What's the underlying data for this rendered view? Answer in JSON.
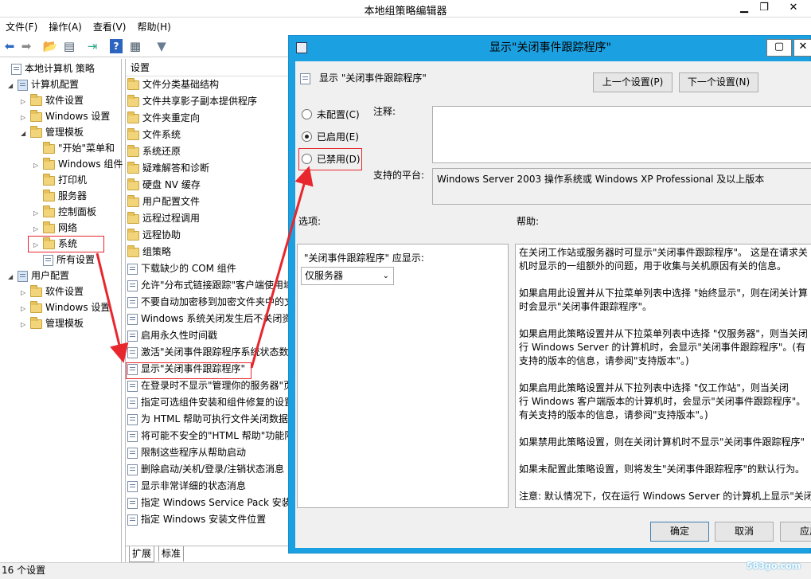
{
  "window": {
    "title": "本地组策略编辑器"
  },
  "menu": [
    "文件(F)",
    "操作(A)",
    "查看(V)",
    "帮助(H)"
  ],
  "tree": [
    {
      "label": "本地计算机 策略",
      "indent": 0,
      "arrow": "",
      "icon": "policy"
    },
    {
      "label": "计算机配置",
      "indent": 1,
      "arrow": "◢",
      "icon": "computer"
    },
    {
      "label": "软件设置",
      "indent": 2,
      "arrow": "▷",
      "icon": "folder"
    },
    {
      "label": "Windows 设置",
      "indent": 2,
      "arrow": "▷",
      "icon": "folder"
    },
    {
      "label": "管理模板",
      "indent": 2,
      "arrow": "◢",
      "icon": "folder"
    },
    {
      "label": "\"开始\"菜单和",
      "indent": 3,
      "arrow": "",
      "icon": "folder"
    },
    {
      "label": "Windows 组件",
      "indent": 3,
      "arrow": "▷",
      "icon": "folder"
    },
    {
      "label": "打印机",
      "indent": 3,
      "arrow": "",
      "icon": "folder"
    },
    {
      "label": "服务器",
      "indent": 3,
      "arrow": "",
      "icon": "folder"
    },
    {
      "label": "控制面板",
      "indent": 3,
      "arrow": "▷",
      "icon": "folder"
    },
    {
      "label": "网络",
      "indent": 3,
      "arrow": "▷",
      "icon": "folder"
    },
    {
      "label": "系统",
      "indent": 3,
      "arrow": "▷",
      "icon": "folder"
    },
    {
      "label": "所有设置",
      "indent": 3,
      "arrow": "",
      "icon": "settings"
    },
    {
      "label": "用户配置",
      "indent": 1,
      "arrow": "◢",
      "icon": "user"
    },
    {
      "label": "软件设置",
      "indent": 2,
      "arrow": "▷",
      "icon": "folder"
    },
    {
      "label": "Windows 设置",
      "indent": 2,
      "arrow": "▷",
      "icon": "folder"
    },
    {
      "label": "管理模板",
      "indent": 2,
      "arrow": "▷",
      "icon": "folder"
    }
  ],
  "list": {
    "header": "设置",
    "items": [
      {
        "label": "文件分类基础结构",
        "type": "folder"
      },
      {
        "label": "文件共享影子副本提供程序",
        "type": "folder"
      },
      {
        "label": "文件夹重定向",
        "type": "folder"
      },
      {
        "label": "文件系统",
        "type": "folder"
      },
      {
        "label": "系统还原",
        "type": "folder"
      },
      {
        "label": "疑难解答和诊断",
        "type": "folder"
      },
      {
        "label": "硬盘 NV 缓存",
        "type": "folder"
      },
      {
        "label": "用户配置文件",
        "type": "folder"
      },
      {
        "label": "远程过程调用",
        "type": "folder"
      },
      {
        "label": "远程协助",
        "type": "folder"
      },
      {
        "label": "组策略",
        "type": "folder"
      },
      {
        "label": "下载缺少的 COM 组件",
        "type": "policy"
      },
      {
        "label": "允许\"分布式链接跟踪\"客户端使用域",
        "type": "policy"
      },
      {
        "label": "不要自动加密移到加密文件夹中的文件",
        "type": "policy"
      },
      {
        "label": "Windows 系统关闭发生后不关闭资源",
        "type": "policy"
      },
      {
        "label": "启用永久性时间戳",
        "type": "policy"
      },
      {
        "label": "激活\"关闭事件跟踪程序系统状态数据\"",
        "type": "policy"
      },
      {
        "label": "显示\"关闭事件跟踪程序\"",
        "type": "policy"
      },
      {
        "label": "在登录时不显示\"管理你的服务器\"页",
        "type": "policy"
      },
      {
        "label": "指定可选组件安装和组件修复的设置",
        "type": "policy"
      },
      {
        "label": "为 HTML 帮助可执行文件关闭数据执行",
        "type": "policy"
      },
      {
        "label": "将可能不安全的\"HTML 帮助\"功能限制",
        "type": "policy"
      },
      {
        "label": "限制这些程序从帮助启动",
        "type": "policy"
      },
      {
        "label": "删除启动/关机/登录/注销状态消息",
        "type": "policy"
      },
      {
        "label": "显示非常详细的状态消息",
        "type": "policy"
      },
      {
        "label": "指定 Windows Service Pack 安装文件",
        "type": "policy"
      },
      {
        "label": "指定 Windows 安装文件位置",
        "type": "policy"
      }
    ],
    "tabs": [
      "扩展",
      "标准"
    ]
  },
  "status": "16 个设置",
  "dialog": {
    "title": "显示\"关闭事件跟踪程序\"",
    "header_label": "显示 \"关闭事件跟踪程序\"",
    "prev_button": "上一个设置(P)",
    "next_button": "下一个设置(N)",
    "radios": [
      {
        "label": "未配置(C)",
        "checked": false
      },
      {
        "label": "已启用(E)",
        "checked": true
      },
      {
        "label": "已禁用(D)",
        "checked": false
      }
    ],
    "comment_label": "注释:",
    "platform_label": "支持的平台:",
    "platform_text": "Windows Server 2003 操作系统或 Windows XP Professional 及以上版本",
    "options_label": "选项:",
    "help_label": "帮助:",
    "option_caption": "\"关闭事件跟踪程序\" 应显示:",
    "option_value": "仅服务器",
    "help_lines": [
      "在关闭工作站或服务器时可显示\"关闭事件跟踪程序\"。 这是在请求关",
      "机时显示的一组额外的问题，用于收集与关机原因有关的信息。",
      "",
      "如果启用此设置并从下拉菜单列表中选择 \"始终显示\"，则在闭关计算",
      "时会显示\"关闭事件跟踪程序\"。",
      "",
      "如果启用此策略设置并从下拉菜单列表中选择 \"仅服务器\"，则当关闭",
      "行 Windows Server 的计算机时，会显示\"关闭事件跟踪程序\"。(有",
      "支持的版本的信息，请参阅\"支持版本\"。)",
      "",
      "如果启用此策略设置并从下拉列表中选择 \"仅工作站\"，则当关闭",
      "行 Windows 客户端版本的计算机时，会显示\"关闭事件跟踪程序\"。",
      "有关支持的版本的信息，请参阅\"支持版本\"。)",
      "",
      "如果禁用此策略设置，则在关闭计算机时不显示\"关闭事件跟踪程序\"",
      "",
      "如果未配置此策略设置，则将发生\"关闭事件跟踪程序\"的默认行为。",
      "",
      "注意: 默认情况下，仅在运行 Windows Server 的计算机上显示\"关闭"
    ],
    "ok_button": "确定",
    "cancel_button": "取消",
    "apply_button": "应用"
  },
  "watermark": "583go.com",
  "colors": {
    "dialog_frame": "#1ba1e2",
    "annotation": "#e8262d"
  }
}
